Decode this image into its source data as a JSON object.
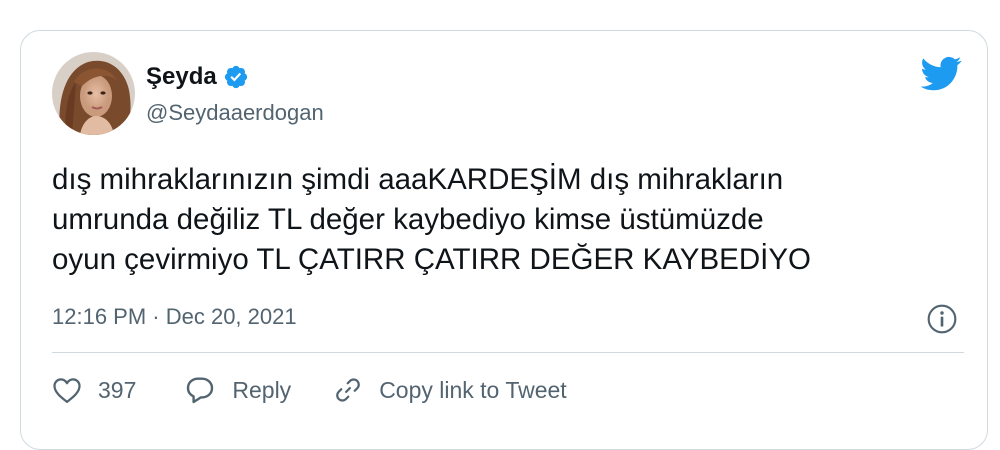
{
  "tweet": {
    "author": {
      "display_name": "Şeyda",
      "handle": "@Seydaaerdogan"
    },
    "text_lines": [
      "dış mihraklarınızın şimdi aaaKARDEŞİM dış mihrakların",
      "umrunda değiliz TL değer kaybediyo kimse üstümüzde",
      "oyun çevirmiyo TL ÇATIRR ÇATIRR DEĞER KAYBEDİYO"
    ],
    "timestamp": "12:16 PM · Dec 20, 2021"
  },
  "actions": {
    "like_count": "397",
    "reply_label": "Reply",
    "copy_link_label": "Copy link to Tweet"
  },
  "colors": {
    "brand_blue": "#1d9bf0",
    "text_primary": "#0f1419",
    "text_secondary": "#536471",
    "border": "#cfd9de"
  }
}
